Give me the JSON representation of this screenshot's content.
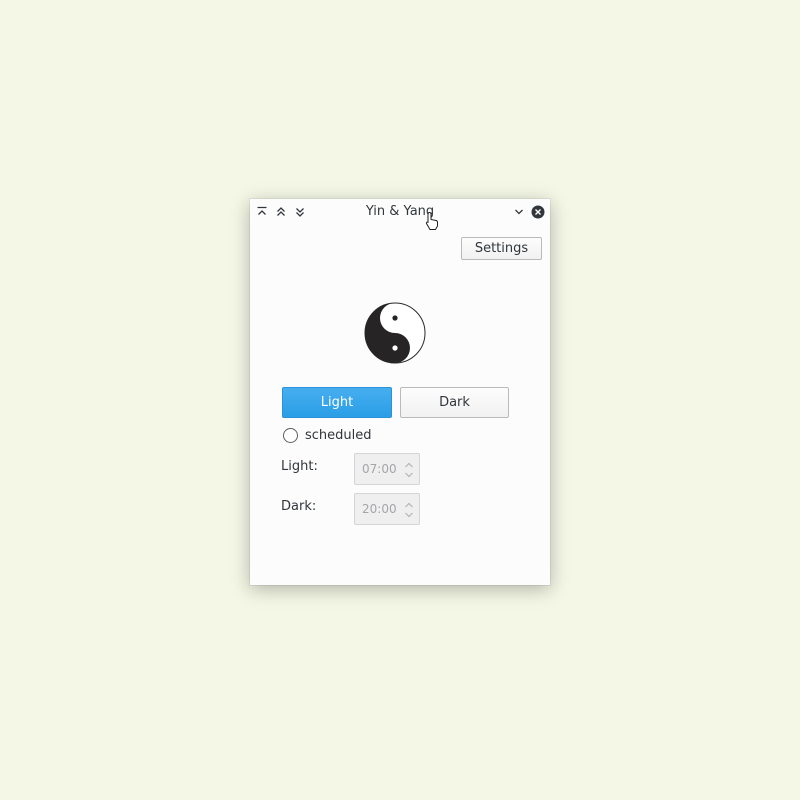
{
  "window": {
    "title": "Yin & Yang"
  },
  "titlebar": {
    "buttons_left": [
      {
        "icon": "keep-above-icon"
      },
      {
        "icon": "raise-icon"
      },
      {
        "icon": "lower-icon"
      }
    ],
    "buttons_right": [
      {
        "icon": "minimize-icon"
      },
      {
        "icon": "close-icon"
      }
    ]
  },
  "toolbar": {
    "settings_label": "Settings"
  },
  "logo": {
    "icon": "yin-yang-icon"
  },
  "theme_buttons": {
    "light_label": "Light",
    "dark_label": "Dark",
    "active": "light",
    "active_color": "#3daee9"
  },
  "schedule": {
    "radio_label": "scheduled",
    "checked": false,
    "light_label": "Light:",
    "light_time": "07:00",
    "dark_label": "Dark:",
    "dark_time": "20:00",
    "enabled": false
  }
}
